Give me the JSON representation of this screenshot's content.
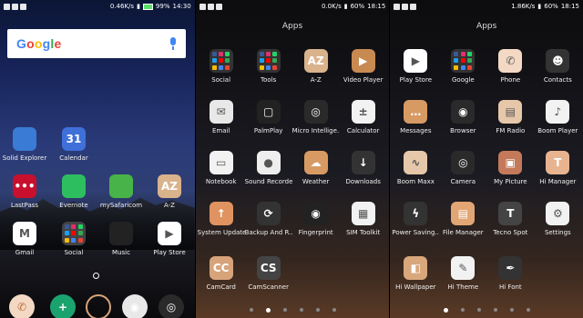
{
  "screens": [
    {
      "status": {
        "speed": "0.46K/s",
        "battery": "99%",
        "time": "14:30"
      },
      "search": {
        "logo": "Google"
      },
      "apps": [
        {
          "label": "Solid Explorer",
          "icon": "solid-explorer-icon",
          "color": "#3a7bd5"
        },
        {
          "label": "Calendar",
          "icon": "calendar-icon",
          "color": "#3f6fd8",
          "text": "31"
        },
        {
          "label": "LastPass",
          "icon": "lastpass-icon",
          "color": "#c8102e",
          "text": "•••"
        },
        {
          "label": "Evernote",
          "icon": "evernote-icon",
          "color": "#2dbe60"
        },
        {
          "label": "mySafaricom",
          "icon": "safaricom-icon",
          "color": "#48b348"
        },
        {
          "label": "A-Z",
          "icon": "az-icon",
          "color": "#d9b38c",
          "text": "AZ"
        },
        {
          "label": "Gmail",
          "icon": "gmail-icon",
          "color": "#ffffff",
          "text": "M"
        },
        {
          "label": "Social",
          "icon": "folder-icon",
          "color": "#444"
        },
        {
          "label": "Music",
          "icon": "music-icon",
          "color": "#222"
        },
        {
          "label": "Play Store",
          "icon": "play-store-icon",
          "color": "#ffffff",
          "text": "▶"
        }
      ],
      "dock": [
        {
          "icon": "phone-icon",
          "color": "#f3d9c4",
          "text": "✆"
        },
        {
          "icon": "add-icon",
          "color": "#1aa36f",
          "text": "+"
        },
        {
          "icon": "circle-icon",
          "color": "transparent",
          "text": "○"
        },
        {
          "icon": "chrome-icon",
          "color": "#e8e8e8",
          "text": "◉"
        },
        {
          "icon": "camera-icon",
          "color": "#2a2a2a",
          "text": "◎"
        }
      ]
    },
    {
      "status": {
        "speed": "0.0K/s",
        "battery": "60%",
        "time": "18:15"
      },
      "title": "Apps",
      "apps": [
        {
          "label": "Social",
          "icon": "folder-icon",
          "color": "#333"
        },
        {
          "label": "Tools",
          "icon": "folder-icon",
          "color": "#333"
        },
        {
          "label": "A-Z",
          "icon": "az-icon",
          "color": "#d9b38c",
          "text": "AZ"
        },
        {
          "label": "Video Player",
          "icon": "video-player-icon",
          "color": "#c98a52",
          "text": "▶"
        },
        {
          "label": "Email",
          "icon": "email-icon",
          "color": "#e8e8e8",
          "text": "✉"
        },
        {
          "label": "PalmPlay",
          "icon": "palmplay-icon",
          "color": "#222",
          "text": "▢"
        },
        {
          "label": "Micro Intellige...",
          "icon": "micro-intelligence-icon",
          "color": "#2a2a2a",
          "text": "◎"
        },
        {
          "label": "Calculator",
          "icon": "calculator-icon",
          "color": "#f2f2f2",
          "text": "±"
        },
        {
          "label": "Notebook",
          "icon": "notebook-icon",
          "color": "#f2f2f2",
          "text": "▭"
        },
        {
          "label": "Sound Recorder",
          "icon": "sound-recorder-icon",
          "color": "#eeeeee",
          "text": "●"
        },
        {
          "label": "Weather",
          "icon": "weather-icon",
          "color": "#d79a63",
          "text": "☁"
        },
        {
          "label": "Downloads",
          "icon": "downloads-icon",
          "color": "#333",
          "text": "↓"
        },
        {
          "label": "System Update",
          "icon": "system-update-icon",
          "color": "#e09360",
          "text": "↑"
        },
        {
          "label": "Backup And R...",
          "icon": "backup-icon",
          "color": "#333",
          "text": "⟳"
        },
        {
          "label": "Fingerprint",
          "icon": "fingerprint-icon",
          "color": "#222",
          "text": "◉"
        },
        {
          "label": "SIM Toolkit",
          "icon": "sim-toolkit-icon",
          "color": "#f2f2f2",
          "text": "▦"
        },
        {
          "label": "CamCard",
          "icon": "camcard-icon",
          "color": "#d7a37a",
          "text": "CC"
        },
        {
          "label": "CamScanner",
          "icon": "camscanner-icon",
          "color": "#444",
          "text": "CS"
        }
      ],
      "pages": [
        false,
        true,
        false,
        false,
        false,
        false
      ]
    },
    {
      "status": {
        "speed": "1.86K/s",
        "battery": "60%",
        "time": "18:15"
      },
      "title": "Apps",
      "apps": [
        {
          "label": "Play Store",
          "icon": "play-store-icon",
          "color": "#ffffff",
          "text": "▶"
        },
        {
          "label": "Google",
          "icon": "folder-icon",
          "color": "#333"
        },
        {
          "label": "Phone",
          "icon": "phone-icon",
          "color": "#f3d9c4",
          "text": "✆"
        },
        {
          "label": "Contacts",
          "icon": "contacts-icon",
          "color": "#333",
          "text": "☻"
        },
        {
          "label": "Messages",
          "icon": "messages-icon",
          "color": "#d79a63",
          "text": "…"
        },
        {
          "label": "Browser",
          "icon": "browser-icon",
          "color": "#2a2a2a",
          "text": "◉"
        },
        {
          "label": "FM Radio",
          "icon": "fm-radio-icon",
          "color": "#e6c7a9",
          "text": "▤"
        },
        {
          "label": "Boom Player",
          "icon": "boom-player-icon",
          "color": "#f2f2f2",
          "text": "♪"
        },
        {
          "label": "Boom Maxx",
          "icon": "boom-maxx-icon",
          "color": "#e6c7a9",
          "text": "∿"
        },
        {
          "label": "Camera",
          "icon": "camera-icon",
          "color": "#2a2a2a",
          "text": "◎"
        },
        {
          "label": "My Picture",
          "icon": "my-picture-icon",
          "color": "#c47a5a",
          "text": "▣"
        },
        {
          "label": "Hi Manager",
          "icon": "hi-manager-icon",
          "color": "#e8b490",
          "text": "T"
        },
        {
          "label": "Power Saving...",
          "icon": "power-saving-icon",
          "color": "#333",
          "text": "ϟ"
        },
        {
          "label": "File Manager",
          "icon": "file-manager-icon",
          "color": "#e2a574",
          "text": "▤"
        },
        {
          "label": "Tecno Spot",
          "icon": "tecno-spot-icon",
          "color": "#444",
          "text": "T"
        },
        {
          "label": "Settings",
          "icon": "settings-icon",
          "color": "#f2f2f2",
          "text": "⚙"
        },
        {
          "label": "Hi Wallpaper",
          "icon": "hi-wallpaper-icon",
          "color": "#d9a77c",
          "text": "◧"
        },
        {
          "label": "Hi Theme",
          "icon": "hi-theme-icon",
          "color": "#f2f2f2",
          "text": "✎"
        },
        {
          "label": "Hi Font",
          "icon": "hi-font-icon",
          "color": "#333",
          "text": "✒"
        }
      ],
      "pages": [
        true,
        false,
        false,
        false,
        false,
        false
      ]
    }
  ]
}
